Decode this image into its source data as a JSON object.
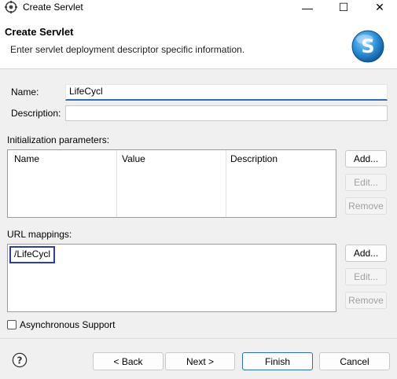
{
  "window": {
    "title": "Create Servlet",
    "minimize_glyph": "—",
    "maximize_glyph": "☐",
    "close_glyph": "✕"
  },
  "banner": {
    "title": "Create Servlet",
    "description": "Enter servlet deployment descriptor specific information.",
    "logo_letter": "S",
    "logo_color": "#2b8fd6"
  },
  "form": {
    "name_label": "Name:",
    "name_value": "LifeCycl",
    "description_label": "Description:",
    "description_value": ""
  },
  "init_params": {
    "section_label": "Initialization parameters:",
    "columns": [
      "Name",
      "Value",
      "Description"
    ],
    "rows": [],
    "add_label": "Add...",
    "edit_label": "Edit...",
    "remove_label": "Remove"
  },
  "url_mappings": {
    "section_label": "URL mappings:",
    "items": [
      "/LifeCycl"
    ],
    "add_label": "Add...",
    "edit_label": "Edit...",
    "remove_label": "Remove"
  },
  "async": {
    "label": "Asynchronous Support",
    "checked": false
  },
  "footer": {
    "back_label": "< Back",
    "next_label": "Next >",
    "finish_label": "Finish",
    "cancel_label": "Cancel",
    "help_glyph": "?"
  },
  "colors": {
    "accent": "#2f6cb3",
    "selection_border": "#2c3fa8"
  }
}
